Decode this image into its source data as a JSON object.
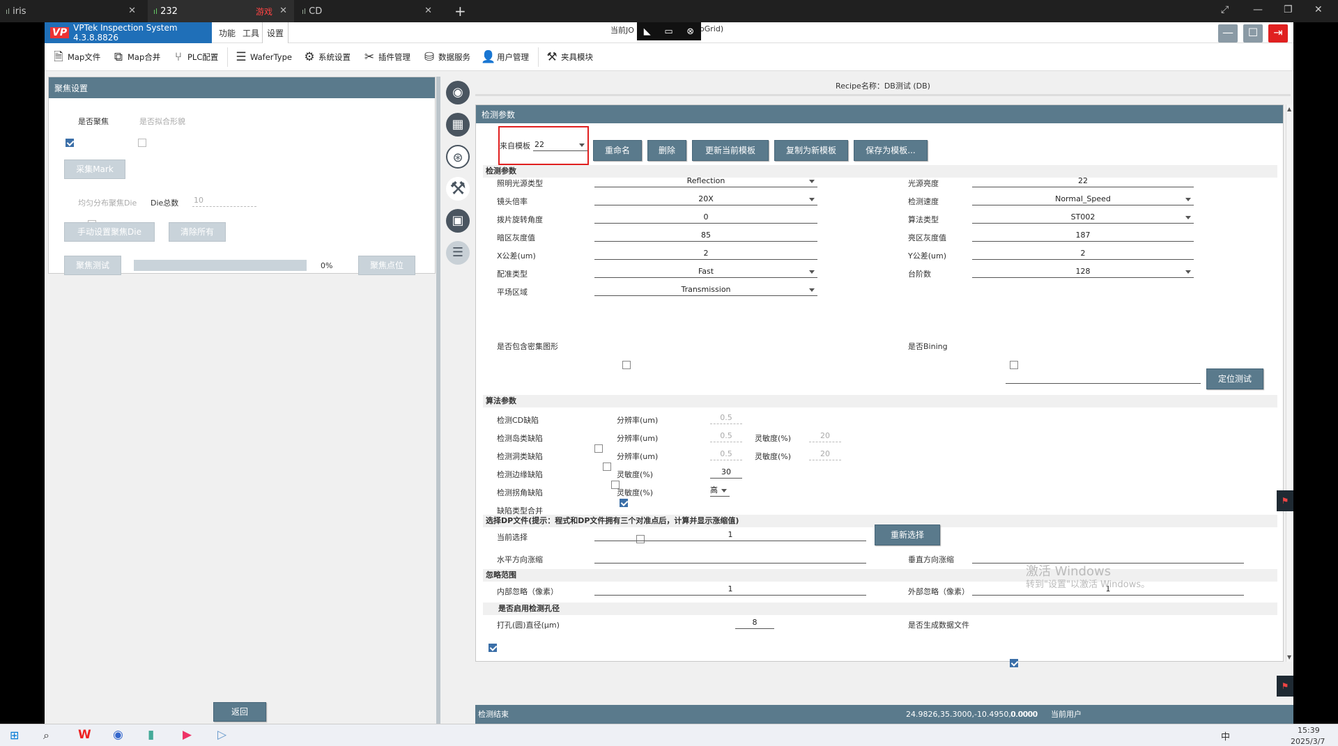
{
  "browser": {
    "tabs": [
      {
        "label": "iris",
        "prefix": "ıl"
      },
      {
        "label": "232",
        "prefix": "ıl",
        "extra": "游戏"
      },
      {
        "label": "CD",
        "prefix": "ıl"
      }
    ],
    "new_tab": "+"
  },
  "app": {
    "title": "VPTek Inspection System 4.3.8.8826",
    "logo": "VP",
    "menus": [
      "功能",
      "工具",
      "设置"
    ],
    "current_job_prefix": "当前JO",
    "current_job_suffix": "oGrid)",
    "toolbar": [
      {
        "label": "Map文件",
        "icon": "map-file-icon"
      },
      {
        "label": "Map合并",
        "icon": "map-merge-icon"
      },
      {
        "label": "PLC配置",
        "icon": "plc-icon"
      },
      {
        "label": "WaferType",
        "icon": "wafer-type-icon"
      },
      {
        "label": "系统设置",
        "icon": "gear-icon"
      },
      {
        "label": "插件管理",
        "icon": "plugin-icon"
      },
      {
        "label": "数据服务",
        "icon": "database-icon"
      },
      {
        "label": "用户管理",
        "icon": "user-icon"
      },
      {
        "label": "夹具模块",
        "icon": "fixture-icon"
      }
    ]
  },
  "focus_panel": {
    "title": "聚焦设置",
    "is_focus": "是否聚焦",
    "is_fit_shape": "是否拟合形貌",
    "collect_mark": "采集Mark",
    "uniform_die": "均匀分布聚焦Die",
    "die_total_label": "Die总数",
    "die_total_value": "10",
    "manual_set": "手动设置聚焦Die",
    "clear_all": "清除所有",
    "focus_test": "聚焦测试",
    "progress_text": "0%",
    "progress": 0,
    "focus_point": "聚焦点位",
    "back": "返回"
  },
  "recipe": "Recipe名称：DB测试 (DB)",
  "detect": {
    "header": "检测参数",
    "template_label": "来自模板",
    "template_value": "22",
    "buttons": [
      "重命名",
      "删除",
      "更新当前模板",
      "复制为新模板",
      "保存为模板..."
    ],
    "section1": "检测参数",
    "left_fields": [
      {
        "label": "照明光源类型",
        "value": "Reflection",
        "dd": true
      },
      {
        "label": "镜头倍率",
        "value": "20X",
        "dd": true
      },
      {
        "label": "拨片旋转角度",
        "value": "0",
        "dd": false
      },
      {
        "label": "暗区灰度值",
        "value": "85",
        "dd": false
      },
      {
        "label": "X公差(um)",
        "value": "2",
        "dd": false
      },
      {
        "label": "配准类型",
        "value": "Fast",
        "dd": true
      },
      {
        "label": "平场区域",
        "value": "Transmission",
        "dd": true
      }
    ],
    "right_fields": [
      {
        "label": "光源亮度",
        "value": "22",
        "dd": false
      },
      {
        "label": "检测速度",
        "value": "Normal_Speed",
        "dd": true
      },
      {
        "label": "算法类型",
        "value": "ST002",
        "dd": true
      },
      {
        "label": "亮区灰度值",
        "value": "187",
        "dd": false
      },
      {
        "label": "Y公差(um)",
        "value": "2",
        "dd": false
      },
      {
        "label": "台阶数",
        "value": "128",
        "dd": true
      }
    ],
    "dense_label": "是否包含密集图形",
    "bining_label": "是否Bining",
    "locate_test": "定位测试",
    "section2": "算法参数",
    "algo_rows": [
      {
        "label": "检测CD缺陷",
        "checked": false,
        "p1": "分辨率(um)",
        "v1": "0.5",
        "v1dim": true,
        "p2": "",
        "v2": ""
      },
      {
        "label": "检测岛类缺陷",
        "checked": false,
        "p1": "分辨率(um)",
        "v1": "0.5",
        "v1dim": true,
        "p2": "灵敏度(%)",
        "v2": "20"
      },
      {
        "label": "检测洞类缺陷",
        "checked": false,
        "p1": "分辨率(um)",
        "v1": "0.5",
        "v1dim": true,
        "p2": "灵敏度(%)",
        "v2": "20"
      },
      {
        "label": "检测边缘缺陷",
        "checked": true,
        "p1": "灵敏度(%)",
        "v1": "30",
        "v1dim": false,
        "p2": "",
        "v2": ""
      },
      {
        "label": "检测拐角缺陷",
        "checked": false,
        "p1": "灵敏度(%)",
        "v1": "高",
        "v1dim": false,
        "p2": "",
        "v2": ""
      },
      {
        "label": "缺陷类型合并",
        "checked": false,
        "p1": "",
        "v1": "",
        "v1dim": false,
        "p2": "",
        "v2": ""
      }
    ],
    "section3": "选择DP文件(提示：程式和DP文件拥有三个对准点后，计算并显示涨缩值)",
    "current_select_label": "当前选择",
    "current_select_value": "1",
    "reselect": "重新选择",
    "h_shrink": "水平方向涨缩",
    "v_shrink": "垂直方向涨缩",
    "section4": "忽略范围",
    "inner_ignore_label": "内部忽略（像素）",
    "inner_ignore_value": "1",
    "outer_ignore_label": "外部忽略（像素）",
    "outer_ignore_value": "1",
    "section5": "是否启用检测孔径",
    "hole_label": "打孔(圆)直径(μm)",
    "hole_value": "8",
    "gen_data_label": "是否生成数据文件"
  },
  "status": {
    "left": "检测结束",
    "coords": "24.9826,35.3000,-10.4950,0.0000",
    "value": "0.0000",
    "user": "当前用户"
  },
  "watermark": {
    "line1": "激活 Windows",
    "line2": "转到\"设置\"以激活 Windows。"
  },
  "taskbar": {
    "time": "15:39",
    "date": "2025/3/7",
    "ime": "中"
  }
}
